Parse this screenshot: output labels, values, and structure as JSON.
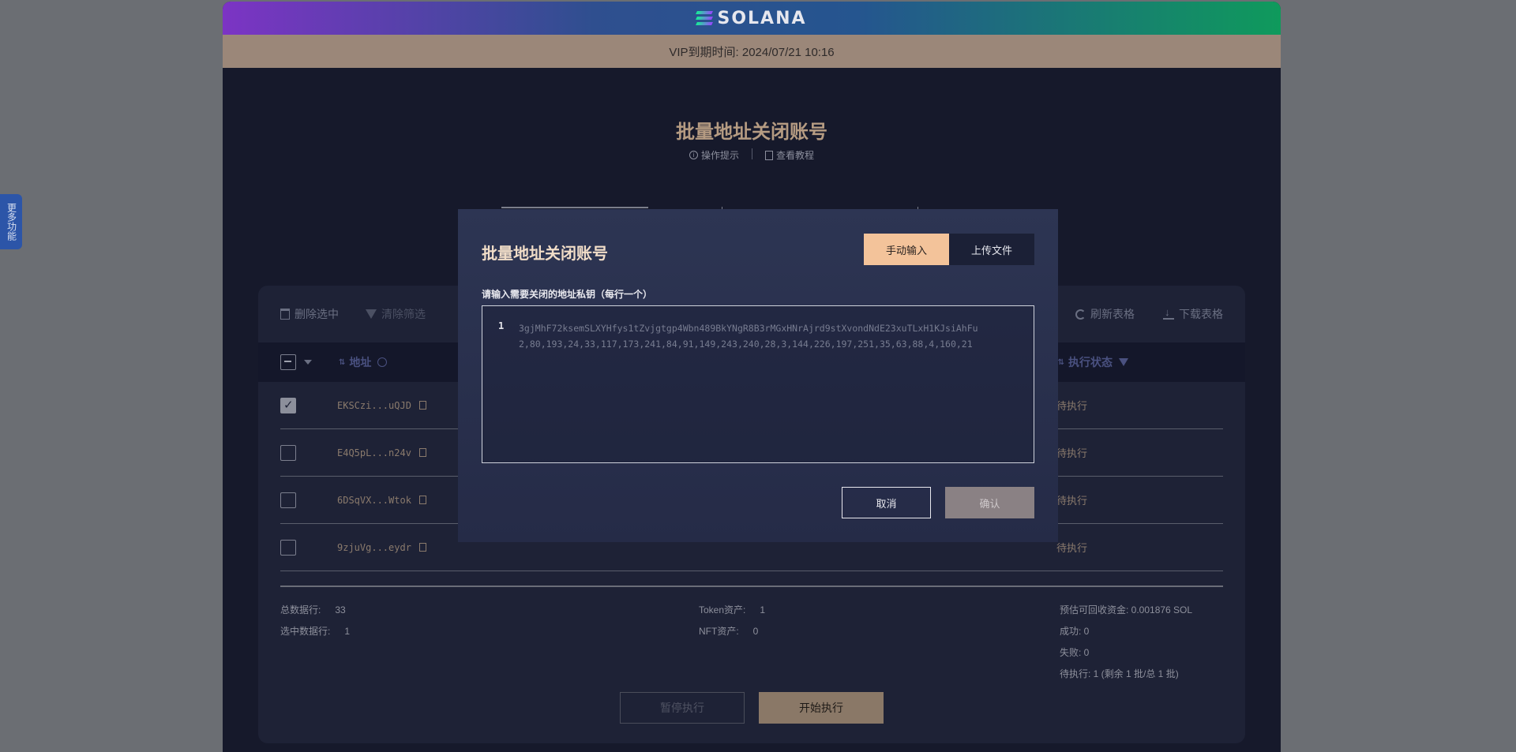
{
  "brand": {
    "logo_text": "SOLANA"
  },
  "vip": {
    "text": "VIP到期时间: 2024/07/21 10:16"
  },
  "page": {
    "title": "批量地址关闭账号",
    "hint_link": "操作提示",
    "tutorial_link": "查看教程"
  },
  "side_tab": {
    "label": "更多功能"
  },
  "toolbar": {
    "delete_selected": "删除选中",
    "clear_filter": "清除筛选",
    "refresh_table": "刷新表格",
    "download_table": "下载表格"
  },
  "table": {
    "headers": {
      "address": "地址",
      "status": "执行状态"
    },
    "rows": [
      {
        "address": "EKSCzi...uQJD",
        "status": "待执行",
        "checked": true
      },
      {
        "address": "E4Q5pL...n24v",
        "status": "待执行",
        "checked": false
      },
      {
        "address": "6DSqVX...Wtok",
        "status": "待执行",
        "checked": false
      },
      {
        "address": "9zjuVg...eydr",
        "status": "待执行",
        "checked": false
      }
    ]
  },
  "summary": {
    "total_label": "总数据行:",
    "total_value": "33",
    "selected_label": "选中数据行:",
    "selected_value": "1",
    "token_label": "Token资产:",
    "token_value": "1",
    "nft_label": "NFT资产:",
    "nft_value": "0",
    "estimate": "预估可回收资金: 0.001876 SOL",
    "success": "成功: 0",
    "fail": "失败: 0",
    "pending": "待执行: 1 (剩余 1 批/总 1 批)"
  },
  "exec": {
    "pause_label": "暂停执行",
    "start_label": "开始执行"
  },
  "modal": {
    "title": "批量地址关闭账号",
    "tab_manual": "手动输入",
    "tab_upload": "上传文件",
    "field_label": "请输入需要关闭的地址私钥（每行一个）",
    "line_number": "1",
    "code_line1": "3gjMhF72ksemSLXYHfys1tZvjgtgp4Wbn489BkYNgR8B3rMGxHNrAjrd9stXvondNdE23xuTLxH1KJsiAhFu",
    "code_line2": "2,80,193,24,33,117,173,241,84,91,149,243,240,28,3,144,226,197,251,35,63,88,4,160,21",
    "cancel_label": "取消",
    "ok_label": "确认"
  },
  "colors": {
    "accent": "#f3c39a",
    "panel": "#1e2236",
    "modal": "#2d3553"
  }
}
